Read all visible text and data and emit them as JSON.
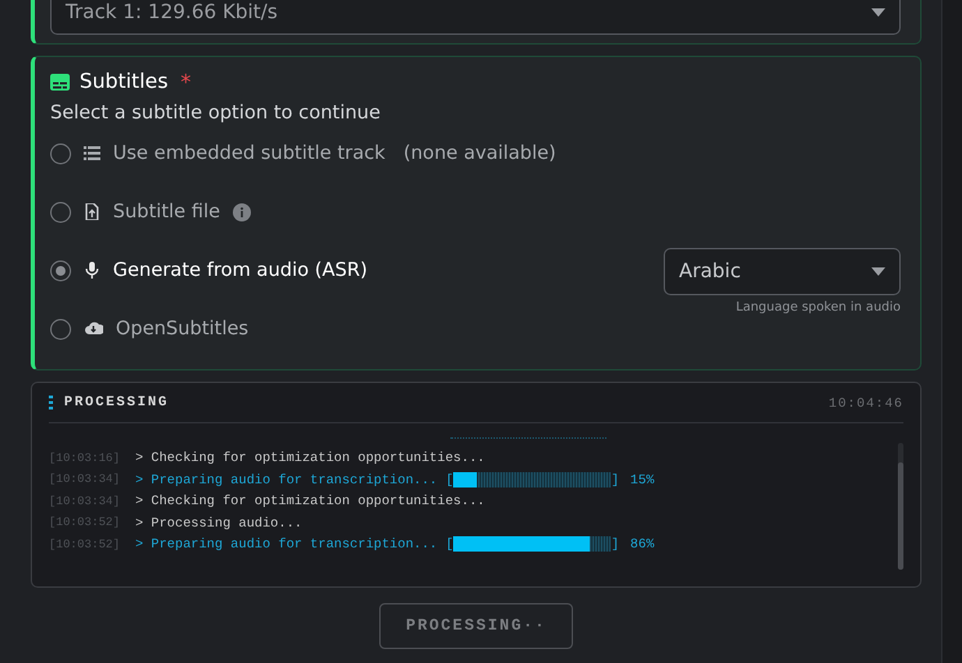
{
  "audio_track": {
    "value": "Track 1: 129.66 Kbit/s"
  },
  "subtitles": {
    "title": "Subtitles",
    "required_mark": "*",
    "prompt": "Select a subtitle option to continue",
    "options": [
      {
        "kind": "embedded",
        "label": "Use embedded subtitle track",
        "note": "(none available)",
        "selected": false
      },
      {
        "kind": "file",
        "label": "Subtitle file",
        "selected": false
      },
      {
        "kind": "asr",
        "label": "Generate from audio (ASR)",
        "selected": true
      },
      {
        "kind": "opensubtitles",
        "label": "OpenSubtitles",
        "selected": false
      }
    ],
    "language": {
      "value": "Arabic",
      "hint": "Language spoken in audio"
    }
  },
  "log": {
    "title": "PROCESSING",
    "time": "10:04:46",
    "lines": [
      {
        "kind": "plain",
        "time": "[10:03:16]",
        "text": "> Checking for optimization opportunities..."
      },
      {
        "kind": "progress",
        "time": "[10:03:34]",
        "text": "> Preparing audio for transcription...",
        "open": "[",
        "close": "]",
        "level": 0.15,
        "percent": "15%"
      },
      {
        "kind": "plain",
        "time": "[10:03:34]",
        "text": "> Checking for optimization opportunities..."
      },
      {
        "kind": "plain",
        "time": "[10:03:52]",
        "text": "> Processing audio..."
      },
      {
        "kind": "progress",
        "time": "[10:03:52]",
        "text": "> Preparing audio for transcription...",
        "open": "[",
        "close": "]",
        "level": 0.86,
        "percent": "86%"
      }
    ]
  },
  "action": {
    "label": "PROCESSING··",
    "disabled": true
  }
}
